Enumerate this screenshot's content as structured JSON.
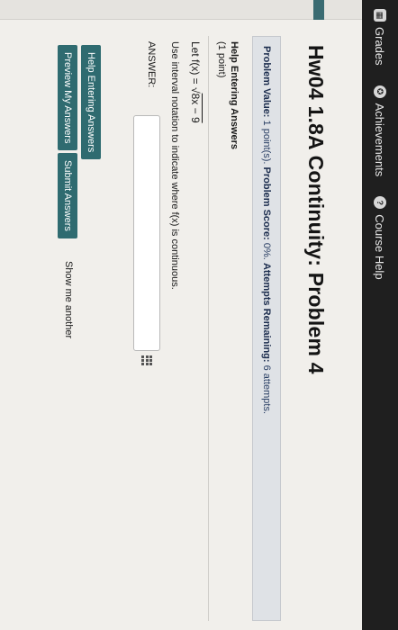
{
  "nav": {
    "grades": "Grades",
    "achievements": "Achievements",
    "course_help": "Course Help"
  },
  "page": {
    "title": "Hw04 1.8A Continuity: Problem 4"
  },
  "info": {
    "value_label": "Problem Value:",
    "value": "1 point(s).",
    "score_label": "Problem Score:",
    "score": "0%.",
    "attempts_label": "Attempts Remaining:",
    "attempts": "6 attempts."
  },
  "problem": {
    "help_link": "Help Entering Answers",
    "points": "(1 point)",
    "prompt_prefix": "Let f(x) = √",
    "prompt_expr": "8x − 9",
    "instruction": "Use interval notation to indicate where f(x) is continuous.",
    "answer_label": "ANSWER:",
    "answer_value": ""
  },
  "actions": {
    "help_button": "Help Entering Answers",
    "preview_button": "Preview My Answers",
    "submit_button": "Submit Answers",
    "show_another": "Show me another"
  },
  "colors": {
    "button": "#2f6b70",
    "topbar": "#1f1f1f",
    "info_strip": "#dfe2e6"
  }
}
